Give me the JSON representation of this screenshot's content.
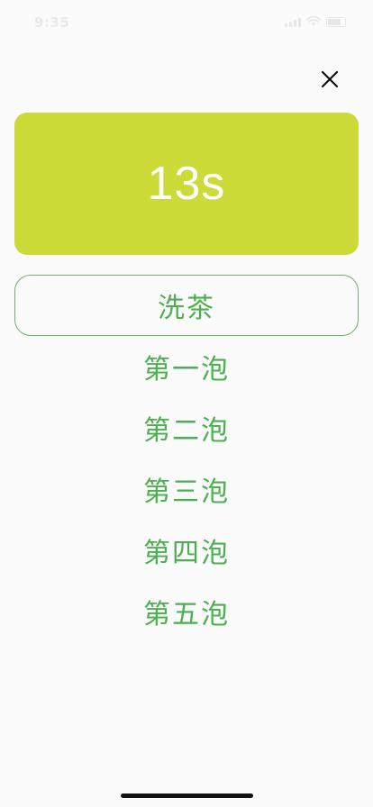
{
  "status_bar": {
    "time": "9:35"
  },
  "timer": {
    "display": "13s",
    "color": "#cddb39"
  },
  "close": {
    "icon": "close-icon"
  },
  "steeps": [
    {
      "label": "洗茶",
      "selected": true
    },
    {
      "label": "第一泡",
      "selected": false
    },
    {
      "label": "第二泡",
      "selected": false
    },
    {
      "label": "第三泡",
      "selected": false
    },
    {
      "label": "第四泡",
      "selected": false
    },
    {
      "label": "第五泡",
      "selected": false
    }
  ],
  "colors": {
    "accent": "#4caf50",
    "background": "#fbfbfb"
  }
}
